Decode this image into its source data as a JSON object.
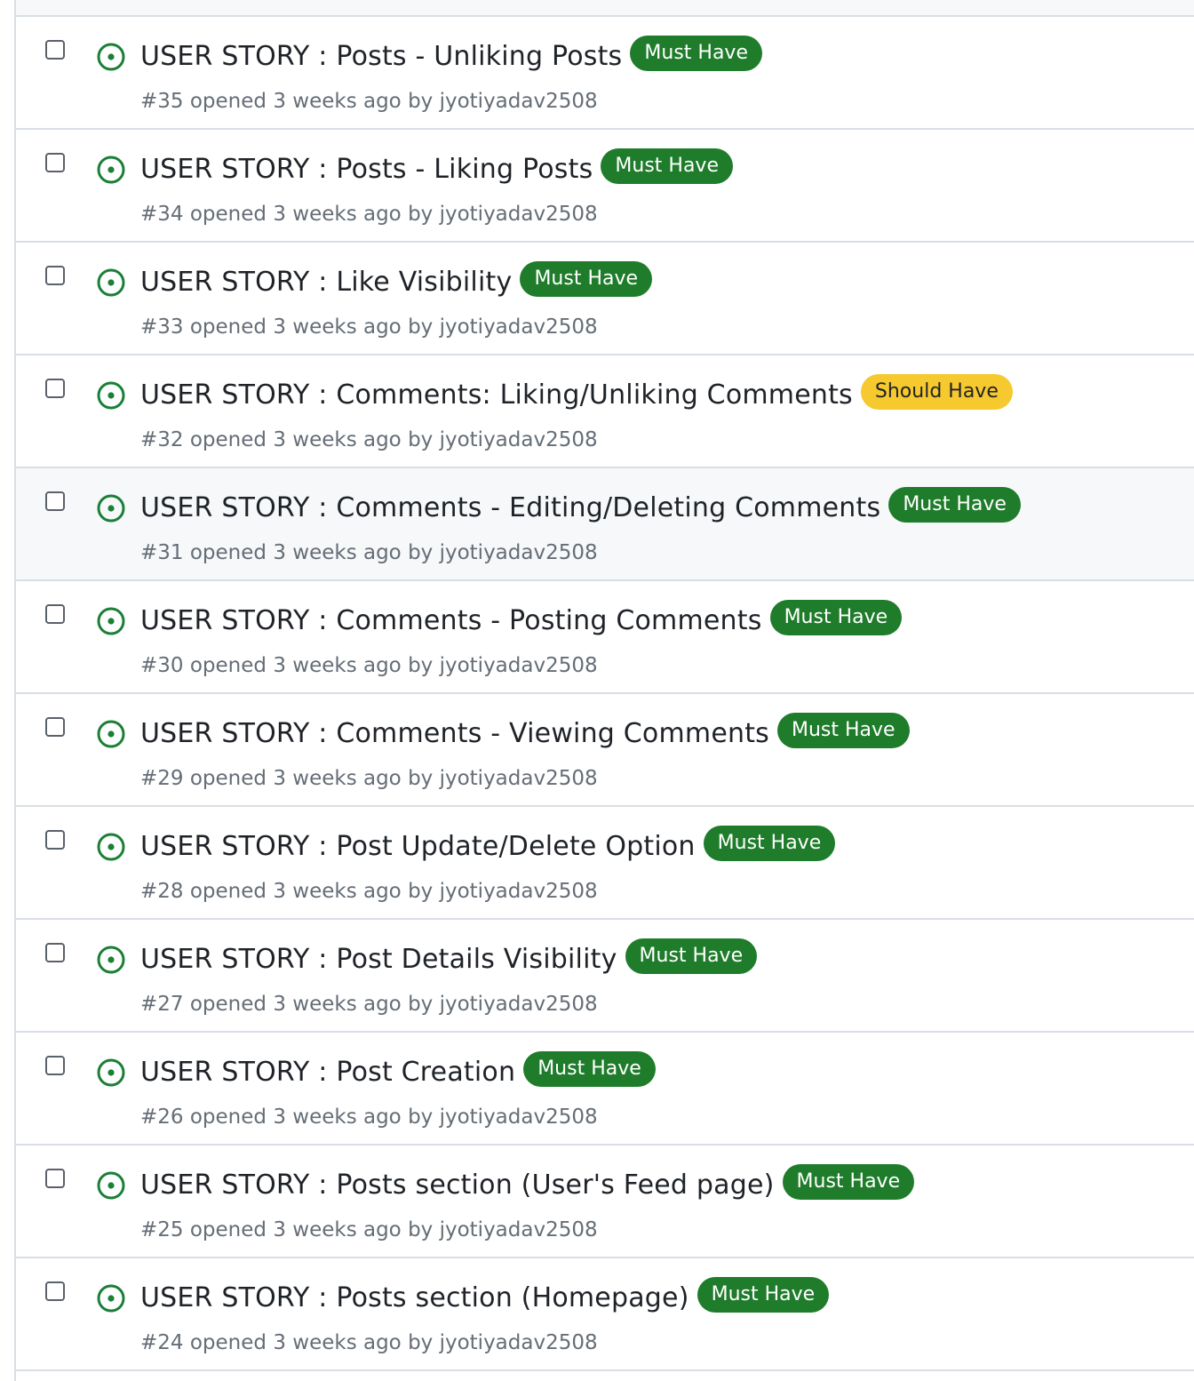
{
  "colors": {
    "open_icon": "#1a7f37",
    "must_have_bg": "#1f7c2b",
    "must_have_fg": "#ffffff",
    "should_have_bg": "#f6c92f",
    "should_have_fg": "#1f2328"
  },
  "issues": [
    {
      "title": "USER STORY : Posts - Unliking Posts",
      "label": "Must Have",
      "label_type": "must",
      "number": "#35",
      "opened_text": "opened 3 weeks ago by",
      "author": "jyotiyadav2508"
    },
    {
      "title": "USER STORY : Posts - Liking Posts",
      "label": "Must Have",
      "label_type": "must",
      "number": "#34",
      "opened_text": "opened 3 weeks ago by",
      "author": "jyotiyadav2508"
    },
    {
      "title": "USER STORY : Like Visibility",
      "label": "Must Have",
      "label_type": "must",
      "number": "#33",
      "opened_text": "opened 3 weeks ago by",
      "author": "jyotiyadav2508"
    },
    {
      "title": "USER STORY : Comments: Liking/Unliking Comments",
      "label": "Should Have",
      "label_type": "should",
      "number": "#32",
      "opened_text": "opened 3 weeks ago by",
      "author": "jyotiyadav2508"
    },
    {
      "title": "USER STORY : Comments - Editing/Deleting Comments",
      "label": "Must Have",
      "label_type": "must",
      "number": "#31",
      "opened_text": "opened 3 weeks ago by",
      "author": "jyotiyadav2508",
      "hovered": true
    },
    {
      "title": "USER STORY : Comments - Posting Comments",
      "label": "Must Have",
      "label_type": "must",
      "number": "#30",
      "opened_text": "opened 3 weeks ago by",
      "author": "jyotiyadav2508"
    },
    {
      "title": "USER STORY : Comments - Viewing Comments",
      "label": "Must Have",
      "label_type": "must",
      "number": "#29",
      "opened_text": "opened 3 weeks ago by",
      "author": "jyotiyadav2508"
    },
    {
      "title": "USER STORY : Post Update/Delete Option",
      "label": "Must Have",
      "label_type": "must",
      "number": "#28",
      "opened_text": "opened 3 weeks ago by",
      "author": "jyotiyadav2508"
    },
    {
      "title": "USER STORY : Post Details Visibility",
      "label": "Must Have",
      "label_type": "must",
      "number": "#27",
      "opened_text": "opened 3 weeks ago by",
      "author": "jyotiyadav2508"
    },
    {
      "title": "USER STORY : Post Creation",
      "label": "Must Have",
      "label_type": "must",
      "number": "#26",
      "opened_text": "opened 3 weeks ago by",
      "author": "jyotiyadav2508"
    },
    {
      "title": "USER STORY : Posts section (User's Feed page)",
      "label": "Must Have",
      "label_type": "must",
      "number": "#25",
      "opened_text": "opened 3 weeks ago by",
      "author": "jyotiyadav2508"
    },
    {
      "title": "USER STORY : Posts section (Homepage)",
      "label": "Must Have",
      "label_type": "must",
      "number": "#24",
      "opened_text": "opened 3 weeks ago by",
      "author": "jyotiyadav2508"
    }
  ]
}
